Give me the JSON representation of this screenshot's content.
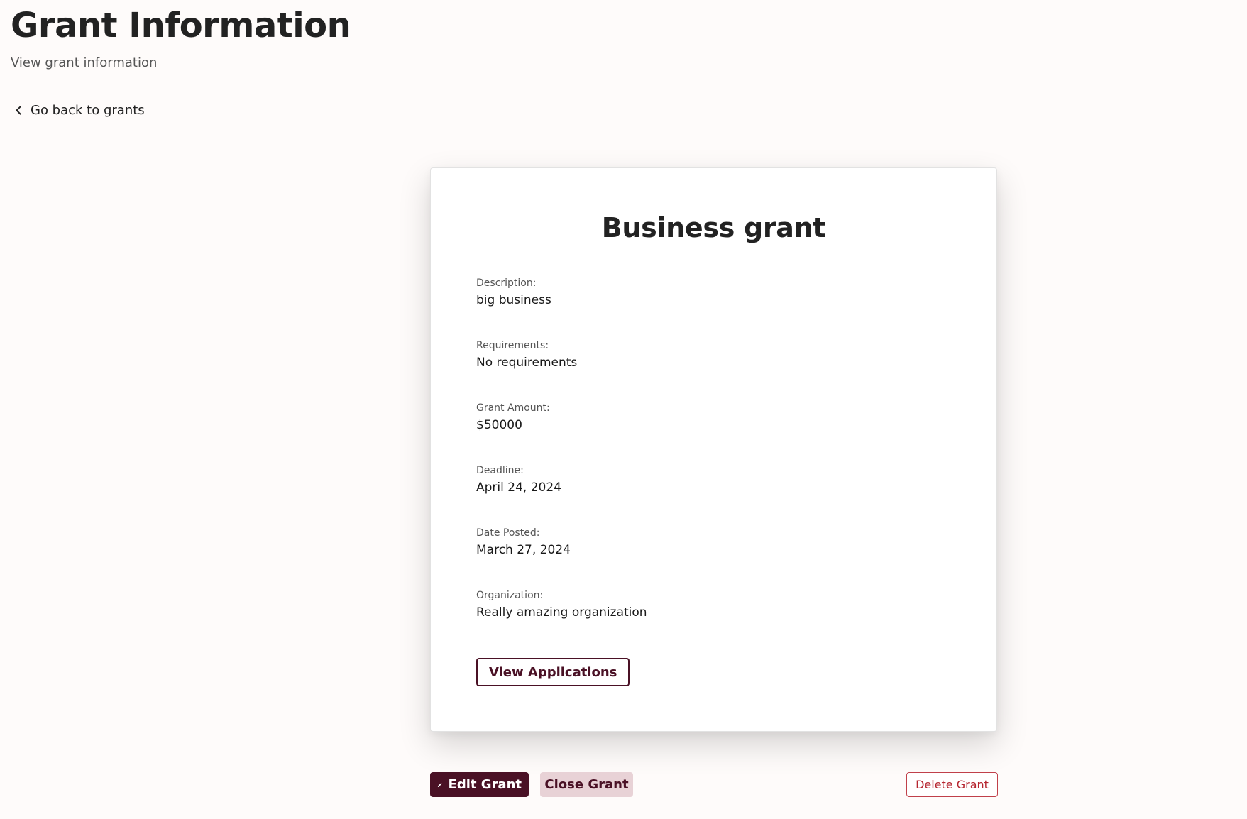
{
  "header": {
    "title": "Grant Information",
    "subtitle": "View grant information"
  },
  "nav": {
    "back_label": "Go back to grants",
    "back_icon": "chevron-left-icon"
  },
  "grant": {
    "title": "Business grant",
    "fields": [
      {
        "label": "Description:",
        "value": "big business"
      },
      {
        "label": "Requirements:",
        "value": "No requirements"
      },
      {
        "label": "Grant Amount:",
        "value": "$50000"
      },
      {
        "label": "Deadline:",
        "value": "April 24, 2024"
      },
      {
        "label": "Date Posted:",
        "value": "March 27, 2024"
      },
      {
        "label": "Organization:",
        "value": "Really amazing organization"
      }
    ],
    "view_applications_label": "View Applications"
  },
  "actions": {
    "edit_label": "Edit Grant",
    "edit_icon": "pencil-icon",
    "close_label": "Close Grant",
    "delete_label": "Delete Grant"
  },
  "colors": {
    "background": "#fefbfa",
    "primary": "#4a1125",
    "secondary": "#e8d2d6",
    "danger": "#b5252f"
  }
}
